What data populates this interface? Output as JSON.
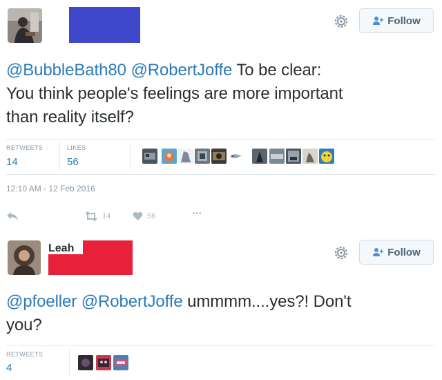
{
  "tweet1": {
    "follow_label": "Follow",
    "mentions": [
      "@BubbleBath80",
      "@RobertJoffe"
    ],
    "text_line1_rest": "To be clear:",
    "text_line2": "You think people's feelings are more important",
    "text_line3": "than reality itself?",
    "stats": {
      "retweets_label": "RETWEETS",
      "retweets_value": "14",
      "likes_label": "LIKES",
      "likes_value": "56"
    },
    "timestamp": "12:10 AM - 12 Feb 2016",
    "actions": {
      "retweet_count": "14",
      "like_count": "56",
      "more": "•••"
    },
    "colors": {
      "redaction": "#3f48cc"
    }
  },
  "tweet2": {
    "name": "Leah",
    "follow_label": "Follow",
    "mentions": [
      "@pfoeller",
      "@RobertJoffe"
    ],
    "text_line1_rest": "ummmm....yes?! Don't",
    "text_line2": "you?",
    "stats": {
      "retweets_label": "RETWEETS",
      "retweets_value": "4"
    },
    "colors": {
      "redaction": "#e8213b"
    }
  },
  "icons": {
    "gear": "gear-icon",
    "follow": "follow-person-icon",
    "reply": "reply-icon",
    "retweet": "retweet-icon",
    "like": "heart-icon",
    "more": "more-icon"
  },
  "colors": {
    "link": "#2b7bb9",
    "text": "#292f33",
    "muted": "#8899a6",
    "border": "#e1e8ed"
  }
}
